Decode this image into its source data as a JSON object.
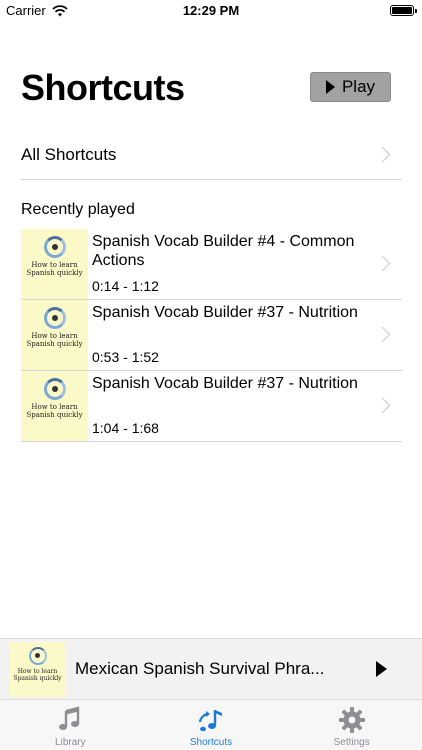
{
  "status_bar": {
    "carrier": "Carrier",
    "time": "12:29 PM"
  },
  "header": {
    "title": "Shortcuts",
    "play_label": "Play"
  },
  "all_shortcuts": {
    "label": "All Shortcuts"
  },
  "recent": {
    "section_title": "Recently played",
    "thumb_text": "How to learn Spanish quickly",
    "items": [
      {
        "title": "Spanish Vocab Builder #4 - Common Actions",
        "time": "0:14 - 1:12"
      },
      {
        "title": "Spanish Vocab Builder #37 - Nutrition",
        "time": "0:53 - 1:52"
      },
      {
        "title": "Spanish Vocab Builder #37 - Nutrition",
        "time": "1:04 - 1:68"
      }
    ]
  },
  "mini_player": {
    "title": "Mexican Spanish Survival Phra...",
    "thumb_text": "How to learn Spanish quickly"
  },
  "tab_bar": {
    "tabs": [
      {
        "label": "Library",
        "icon": "music-note-icon"
      },
      {
        "label": "Shortcuts",
        "icon": "shortcut-music-icon",
        "active": true
      },
      {
        "label": "Settings",
        "icon": "gear-icon"
      }
    ]
  },
  "colors": {
    "accent": "#1e7ad6",
    "thumb_bg": "#fbf9c8",
    "play_button_bg": "#a2a2a2",
    "inactive_tab": "#8e8e93"
  }
}
